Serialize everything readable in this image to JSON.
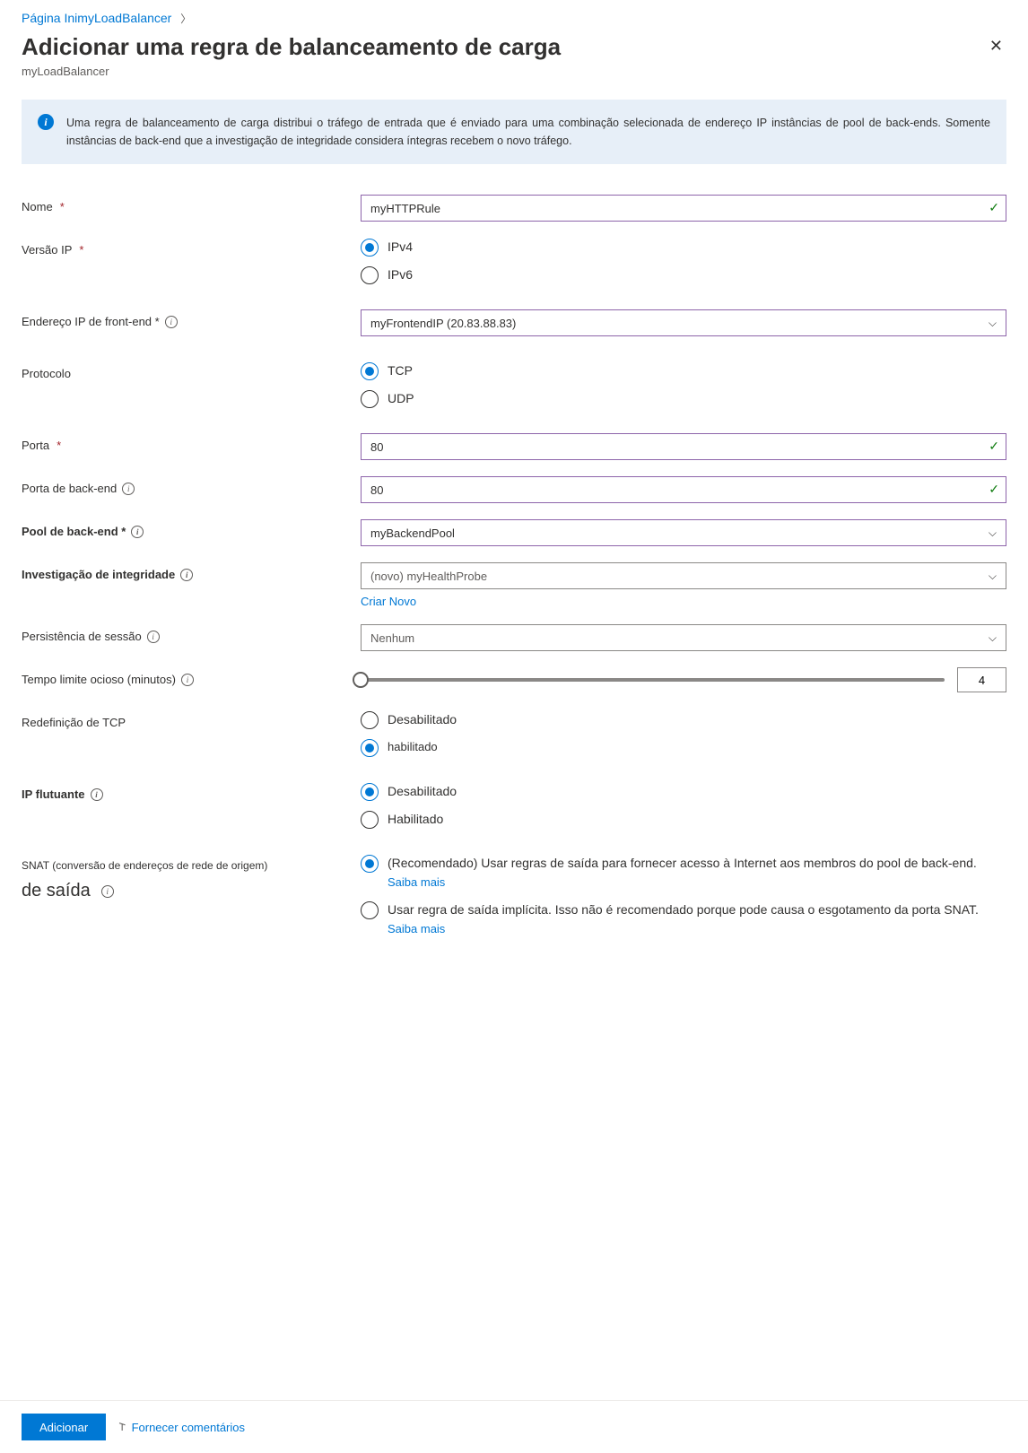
{
  "breadcrumb": {
    "home": "Página Ini",
    "resource": "myLoadBalancer"
  },
  "header": {
    "title": "Adicionar uma regra de balanceamento de carga",
    "subtitle": "myLoadBalancer"
  },
  "info": {
    "text": "Uma regra de balanceamento de carga distribui o tráfego de entrada que é enviado para uma combinação selecionada de endereço IP instâncias de pool de back-ends. Somente instâncias de back-end que a investigação de integridade considera íntegras recebem o novo tráfego."
  },
  "fields": {
    "name": {
      "label": "Nome",
      "value": "myHTTPRule"
    },
    "ip_version": {
      "label": "Versão IP",
      "options": [
        "IPv4",
        "IPv6"
      ],
      "selected": "IPv4"
    },
    "frontend": {
      "label": "Endereço IP de front-end *",
      "value": "myFrontendIP (20.83.88.83)"
    },
    "protocol": {
      "label": "Protocolo",
      "options": [
        "TCP",
        "UDP"
      ],
      "selected": "TCP"
    },
    "port": {
      "label": "Porta",
      "value": "80"
    },
    "backend_port": {
      "label": "Porta de back-end",
      "value": "80"
    },
    "backend_pool": {
      "label": "Pool de back-end *",
      "value": "myBackendPool"
    },
    "health_probe": {
      "label": "Investigação de integridade",
      "value": "(novo) myHealthProbe",
      "create_new": "Criar Novo"
    },
    "session": {
      "label": "Persistência de sessão",
      "value": "Nenhum"
    },
    "idle": {
      "label": "Tempo limite ocioso (minutos)",
      "value": "4"
    },
    "tcp_reset": {
      "label": "Redefinição de TCP",
      "options": [
        "Desabilitado",
        "habilitado"
      ],
      "selected": "habilitado"
    },
    "floating_ip": {
      "label": "IP flutuante",
      "options": [
        "Desabilitado",
        "Habilitado"
      ],
      "selected": "Desabilitado"
    },
    "snat": {
      "label_a": "SNAT (conversão de endereços de rede de origem)",
      "label_b": "de saída",
      "opt1_a": "(Recomendado) Usar regras de saída para fornecer acesso à Internet aos membros do pool de back-end. ",
      "opt1_link": "Saiba mais",
      "opt2_a": "Usar regra de saída implícita. Isso não é recomendado porque pode causa o esgotamento da porta SNAT. ",
      "opt2_link": "Saiba mais",
      "selected": 0
    }
  },
  "footer": {
    "add": "Adicionar",
    "feedback": "Fornecer comentários"
  }
}
